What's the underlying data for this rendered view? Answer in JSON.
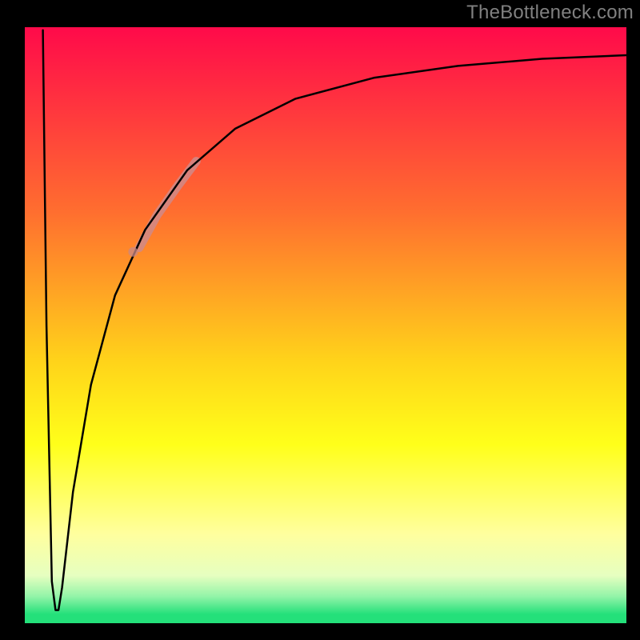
{
  "watermark": "TheBottleneck.com",
  "chart_data": {
    "type": "line",
    "title": "",
    "xlabel": "",
    "ylabel": "",
    "xlim": [
      0,
      100
    ],
    "ylim": [
      0,
      100
    ],
    "background_gradient": {
      "stops": [
        {
          "offset": 0.0,
          "color": "#ff0a4a"
        },
        {
          "offset": 0.31,
          "color": "#ff6e2f"
        },
        {
          "offset": 0.56,
          "color": "#ffd31a"
        },
        {
          "offset": 0.7,
          "color": "#ffff1a"
        },
        {
          "offset": 0.85,
          "color": "#ffff9e"
        },
        {
          "offset": 0.92,
          "color": "#e6ffc0"
        },
        {
          "offset": 0.955,
          "color": "#93f4a8"
        },
        {
          "offset": 0.985,
          "color": "#24e07a"
        }
      ]
    },
    "series": [
      {
        "name": "curve",
        "stroke": "#000000",
        "points": [
          {
            "x": 3.0,
            "y": 99.5
          },
          {
            "x": 3.6,
            "y": 50.0
          },
          {
            "x": 4.5,
            "y": 7.0
          },
          {
            "x": 5.1,
            "y": 2.2
          },
          {
            "x": 5.6,
            "y": 2.2
          },
          {
            "x": 6.2,
            "y": 6.0
          },
          {
            "x": 8.0,
            "y": 22.0
          },
          {
            "x": 11.0,
            "y": 40.0
          },
          {
            "x": 15.0,
            "y": 55.0
          },
          {
            "x": 20.0,
            "y": 66.0
          },
          {
            "x": 27.0,
            "y": 76.0
          },
          {
            "x": 35.0,
            "y": 83.0
          },
          {
            "x": 45.0,
            "y": 88.0
          },
          {
            "x": 58.0,
            "y": 91.5
          },
          {
            "x": 72.0,
            "y": 93.5
          },
          {
            "x": 86.0,
            "y": 94.7
          },
          {
            "x": 100.0,
            "y": 95.3
          }
        ]
      },
      {
        "name": "highlight-segment",
        "stroke": "#d08a88",
        "stroke_width": 11,
        "opacity": 0.85,
        "points": [
          {
            "x": 19.0,
            "y": 63.0
          },
          {
            "x": 22.0,
            "y": 68.5
          },
          {
            "x": 25.5,
            "y": 73.5
          },
          {
            "x": 28.5,
            "y": 77.5
          }
        ]
      },
      {
        "name": "highlight-dot",
        "stroke": "#c98886",
        "type_hint": "marker",
        "points": [
          {
            "x": 18.0,
            "y": 62.3
          }
        ]
      }
    ],
    "frame": {
      "color": "#000000",
      "left_width": 31,
      "right_width": 17,
      "top_width": 34,
      "bottom_width": 21
    }
  }
}
